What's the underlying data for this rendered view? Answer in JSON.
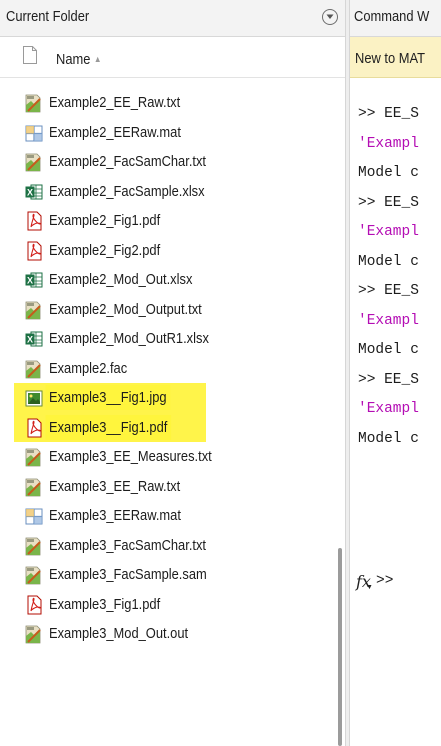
{
  "current_folder": {
    "title": "Current Folder",
    "column_header": {
      "label": "Name",
      "sort_icon": "sort-ascending-icon"
    },
    "files": [
      {
        "name": "Example2_EE_Raw.txt",
        "icon": "text-file-icon",
        "highlighted": false
      },
      {
        "name": "Example2_EERaw.mat",
        "icon": "mat-file-icon",
        "highlighted": false
      },
      {
        "name": "Example2_FacSamChar.txt",
        "icon": "text-file-icon",
        "highlighted": false
      },
      {
        "name": "Example2_FacSample.xlsx",
        "icon": "excel-file-icon",
        "highlighted": false
      },
      {
        "name": "Example2_Fig1.pdf",
        "icon": "pdf-file-icon",
        "highlighted": false
      },
      {
        "name": "Example2_Fig2.pdf",
        "icon": "pdf-file-icon",
        "highlighted": false
      },
      {
        "name": "Example2_Mod_Out.xlsx",
        "icon": "excel-file-icon",
        "highlighted": false
      },
      {
        "name": "Example2_Mod_Output.txt",
        "icon": "text-file-icon",
        "highlighted": false
      },
      {
        "name": "Example2_Mod_OutR1.xlsx",
        "icon": "excel-file-icon",
        "highlighted": false
      },
      {
        "name": "Example2.fac",
        "icon": "text-file-icon",
        "highlighted": false
      },
      {
        "name": "Example3__Fig1.jpg",
        "icon": "image-file-icon",
        "highlighted": true
      },
      {
        "name": "Example3__Fig1.pdf",
        "icon": "pdf-file-icon",
        "highlighted": true
      },
      {
        "name": "Example3_EE_Measures.txt",
        "icon": "text-file-icon",
        "highlighted": false
      },
      {
        "name": "Example3_EE_Raw.txt",
        "icon": "text-file-icon",
        "highlighted": false
      },
      {
        "name": "Example3_EERaw.mat",
        "icon": "mat-file-icon",
        "highlighted": false
      },
      {
        "name": "Example3_FacSamChar.txt",
        "icon": "text-file-icon",
        "highlighted": false
      },
      {
        "name": "Example3_FacSample.sam",
        "icon": "text-file-icon",
        "highlighted": false
      },
      {
        "name": "Example3_Fig1.pdf",
        "icon": "pdf-file-icon",
        "highlighted": false
      },
      {
        "name": "Example3_Mod_Out.out",
        "icon": "text-file-icon",
        "highlighted": false
      }
    ]
  },
  "command_window": {
    "title": "Command W",
    "notice": "New to MAT",
    "lines": [
      {
        "text": ">> EE_S",
        "style": "prompt"
      },
      {
        "text": "'Exampl",
        "style": "str"
      },
      {
        "text": "Model c",
        "style": "plain"
      },
      {
        "text": ">> EE_S",
        "style": "prompt"
      },
      {
        "text": "'Exampl",
        "style": "str"
      },
      {
        "text": "Model c",
        "style": "plain"
      },
      {
        "text": ">> EE_S",
        "style": "prompt"
      },
      {
        "text": "'Exampl",
        "style": "str"
      },
      {
        "text": "Model c",
        "style": "plain"
      },
      {
        "text": ">> EE_S",
        "style": "prompt"
      },
      {
        "text": "'Exampl",
        "style": "str"
      },
      {
        "text": "Model c",
        "style": "plain"
      }
    ],
    "fx_label": "fx",
    "prompt": ">>"
  },
  "colors": {
    "highlight": "#fff44a",
    "string": "#b40db4",
    "notice_bg": "#fbf2c4"
  }
}
